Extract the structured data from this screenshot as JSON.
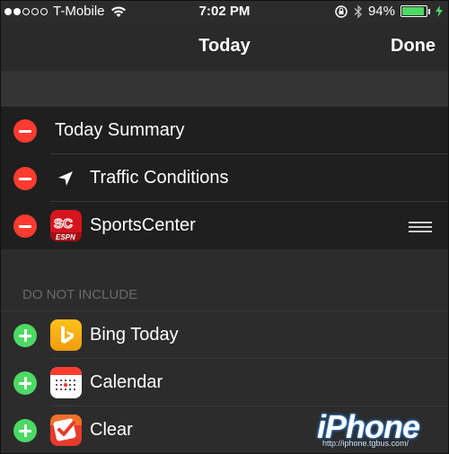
{
  "status_bar": {
    "carrier": "T-Mobile",
    "time": "7:02 PM",
    "battery_text": "94%",
    "battery_level": 0.94,
    "signal_bars_filled": 2,
    "signal_bars_total": 5
  },
  "nav": {
    "title": "Today",
    "done_label": "Done"
  },
  "included": [
    {
      "label": "Today Summary",
      "icon": "none"
    },
    {
      "label": "Traffic Conditions",
      "icon": "location-arrow-icon"
    },
    {
      "label": "SportsCenter",
      "icon": "sportscenter-espn-icon"
    }
  ],
  "excluded_header": "DO NOT INCLUDE",
  "excluded": [
    {
      "label": "Bing Today",
      "icon": "bing-icon"
    },
    {
      "label": "Calendar",
      "icon": "calendar-icon"
    },
    {
      "label": "Clear",
      "icon": "clear-icon"
    }
  ],
  "watermark": {
    "brand": "iPhone",
    "url": "http://iphone.tgbus.com/"
  },
  "colors": {
    "remove": "#ff3b30",
    "add": "#4cd964",
    "battery": "#4cd964"
  }
}
